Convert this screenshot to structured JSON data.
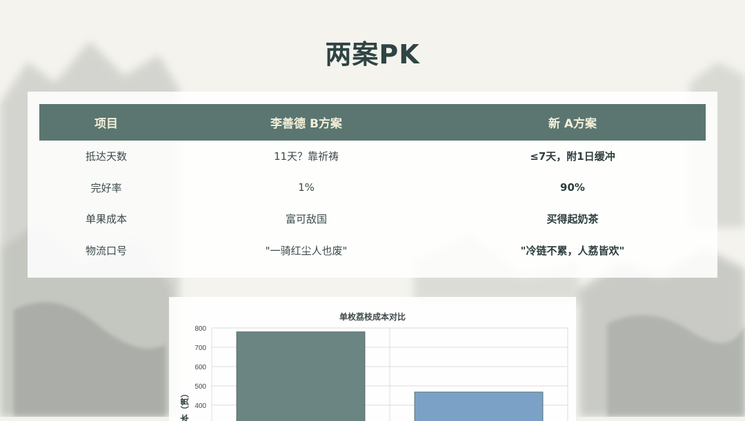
{
  "slide": {
    "title": "两案PK"
  },
  "table": {
    "headers": [
      "项目",
      "李善德 B方案",
      "新 A方案"
    ],
    "rows": [
      {
        "item": "抵达天数",
        "b": "11天？靠祈祷",
        "a": "≤7天，附1日缓冲"
      },
      {
        "item": "完好率",
        "b": "1%",
        "a": "90%"
      },
      {
        "item": "单果成本",
        "b": "富可敌国",
        "a": "买得起奶茶"
      },
      {
        "item": "物流口号",
        "b": "\"一骑红尘人也废\"",
        "a": "\"冷链不累，人荔皆欢\""
      }
    ]
  },
  "chart_data": {
    "type": "bar",
    "title": "单枚荔枝成本对比",
    "ylabel": "本（贯）",
    "ylim": [
      0,
      800
    ],
    "yticks": [
      400,
      500,
      600,
      700,
      800
    ],
    "values": [
      780,
      468
    ],
    "colors": [
      "#6b8582",
      "#7ba2c6"
    ],
    "grid": true
  }
}
